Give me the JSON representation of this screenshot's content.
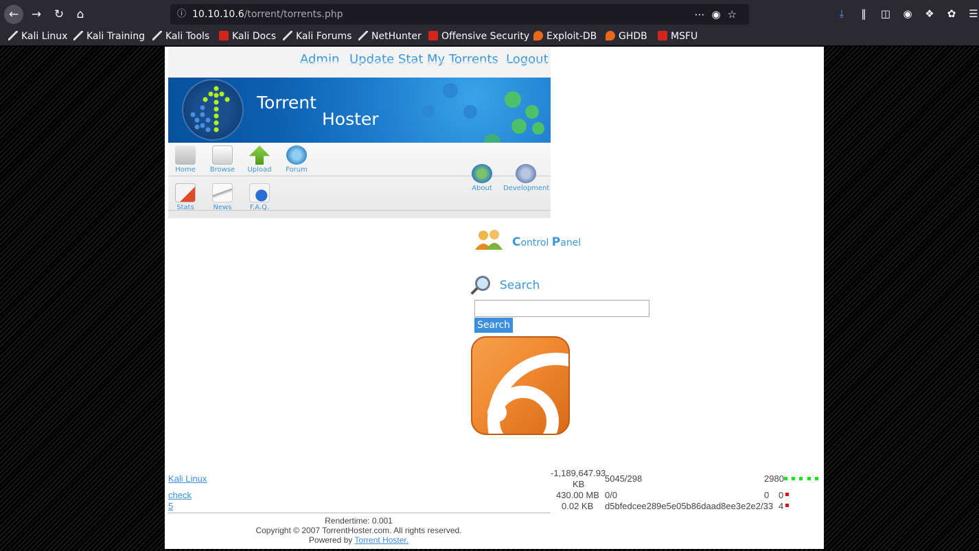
{
  "browser": {
    "url_host": "10.10.10.6",
    "url_path": "/torrent/torrents.php",
    "bookmarks": [
      "Kali Linux",
      "Kali Training",
      "Kali Tools",
      "Kali Docs",
      "Kali Forums",
      "NetHunter",
      "Offensive Security",
      "Exploit-DB",
      "GHDB",
      "MSFU"
    ]
  },
  "topnav": [
    "Admin",
    "Update Stat",
    "My Torrents",
    "Logout"
  ],
  "banner": {
    "line1": "Torrent",
    "line2": "Hoster"
  },
  "menu": {
    "row1": [
      "Home",
      "Browse",
      "Upload",
      "Forum"
    ],
    "row2": [
      "Stats",
      "News",
      "F.A.Q."
    ],
    "right": [
      "About",
      "Development"
    ]
  },
  "control_panel": {
    "c": "C",
    "rest1": "ontrol ",
    "p": "P",
    "rest2": "anel"
  },
  "search": {
    "title": "Search",
    "button": "Search",
    "value": ""
  },
  "torrents": [
    {
      "name": "Kali Linux",
      "size1": "-1,189,647.93",
      "size2": "KB",
      "peers": "5045/298",
      "count": "2980"
    },
    {
      "name": "check",
      "size1": "430.00 MB",
      "peers": "0/0",
      "count1": "0",
      "count2": "0"
    },
    {
      "name": "5",
      "size1": "0.02 KB",
      "peers": "d5bfedcee289e5e05b86daad8ee3e2e2/33",
      "count2": "4"
    }
  ],
  "footer": {
    "rendertime": "Rendertime: 0.001",
    "copyright": "Copyright © 2007 TorrentHoster.com. All rights reserved.",
    "powered_prefix": "Powered by",
    "powered_link": "Torrent Hoster."
  },
  "colors": {
    "accent": "#3b97d9",
    "chrome": "#2b2a33",
    "green_bar": "#19e619",
    "red_bar": "#e01010"
  }
}
